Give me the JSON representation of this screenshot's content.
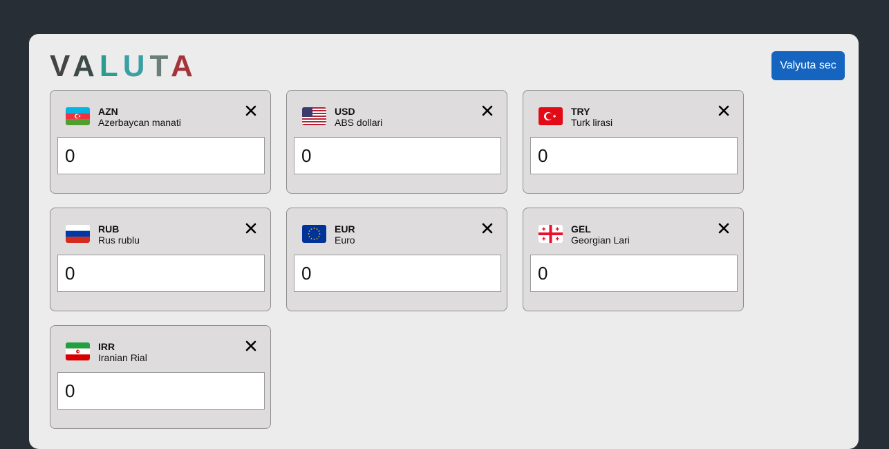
{
  "header": {
    "logo_letters": [
      {
        "char": "V",
        "color": "#444444"
      },
      {
        "char": "A",
        "color": "#3e4a48"
      },
      {
        "char": "L",
        "color": "#2a9d8f"
      },
      {
        "char": "U",
        "color": "#3aa0a4"
      },
      {
        "char": "T",
        "color": "#6b7f7a"
      },
      {
        "char": "A",
        "color": "#a4343a"
      }
    ],
    "select_button_label": "Valyuta sec",
    "accent_color": "#1565c0"
  },
  "currencies": [
    {
      "code": "AZN",
      "name": "Azerbaycan manati",
      "value": "0",
      "flag": "azerbaijan-flag-icon"
    },
    {
      "code": "USD",
      "name": "ABS dollari",
      "value": "0",
      "flag": "usa-flag-icon"
    },
    {
      "code": "TRY",
      "name": "Turk lirasi",
      "value": "0",
      "flag": "turkey-flag-icon"
    },
    {
      "code": "RUB",
      "name": "Rus rublu",
      "value": "0",
      "flag": "russia-flag-icon"
    },
    {
      "code": "EUR",
      "name": "Euro",
      "value": "0",
      "flag": "eu-flag-icon"
    },
    {
      "code": "GEL",
      "name": "Georgian Lari",
      "value": "0",
      "flag": "georgia-flag-icon"
    },
    {
      "code": "IRR",
      "name": "Iranian Rial",
      "value": "0",
      "flag": "iran-flag-icon"
    }
  ]
}
